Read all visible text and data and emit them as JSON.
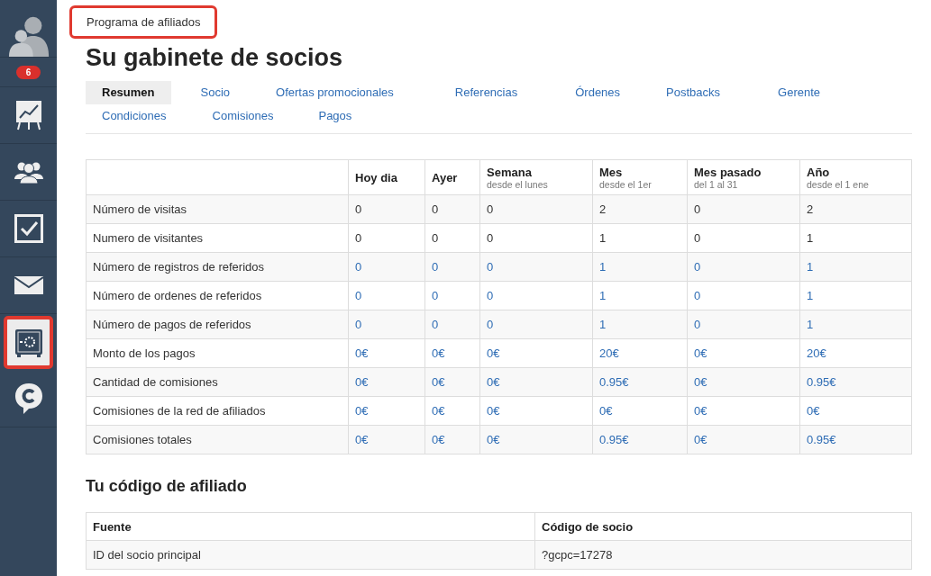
{
  "sidebar": {
    "badge": "6",
    "items": [
      {
        "kind": "chart",
        "selected": false,
        "highlighted": false
      },
      {
        "kind": "people",
        "selected": false,
        "highlighted": false
      },
      {
        "kind": "check",
        "selected": false,
        "highlighted": false
      },
      {
        "kind": "mail",
        "selected": false,
        "highlighted": false
      },
      {
        "kind": "safe",
        "selected": true,
        "highlighted": true
      },
      {
        "kind": "chat",
        "selected": false,
        "highlighted": false
      }
    ]
  },
  "breadcrumb": {
    "label": "Programa de afiliados",
    "highlighted": true
  },
  "title": "Su gabinete de socios",
  "tabs": [
    {
      "label": "Resumen",
      "selected": true
    },
    {
      "label": "Socio",
      "selected": false
    },
    {
      "label": "Ofertas promocionales",
      "selected": false
    },
    {
      "label": "Referencias",
      "selected": false
    },
    {
      "label": "Órdenes",
      "selected": false
    },
    {
      "label": "Postbacks",
      "selected": false
    },
    {
      "label": "Gerente",
      "selected": false
    },
    {
      "label": "Condiciones",
      "selected": false
    },
    {
      "label": "Comisiones",
      "selected": false
    },
    {
      "label": "Pagos",
      "selected": false
    }
  ],
  "stats_table": {
    "columns": [
      {
        "title": "Hoy dia"
      },
      {
        "title": "Ayer"
      },
      {
        "title": "Semana",
        "subtitle": "desde el lunes"
      },
      {
        "title": "Mes",
        "subtitle": "desde el 1er"
      },
      {
        "title": "Mes pasado",
        "subtitle": "del 1 al 31"
      },
      {
        "title": "Año",
        "subtitle": "desde el 1 ene"
      }
    ],
    "rows": [
      {
        "label": "Número de visitas",
        "linked": false,
        "values": [
          "0",
          "0",
          "0",
          "2",
          "0",
          "2"
        ]
      },
      {
        "label": "Numero de visitantes",
        "linked": false,
        "values": [
          "0",
          "0",
          "0",
          "1",
          "0",
          "1"
        ]
      },
      {
        "label": "Número de registros de referidos",
        "linked": true,
        "values": [
          "0",
          "0",
          "0",
          "1",
          "0",
          "1"
        ]
      },
      {
        "label": "Número de ordenes de referidos",
        "linked": true,
        "values": [
          "0",
          "0",
          "0",
          "1",
          "0",
          "1"
        ]
      },
      {
        "label": "Número de pagos de referidos",
        "linked": true,
        "values": [
          "0",
          "0",
          "0",
          "1",
          "0",
          "1"
        ]
      },
      {
        "label": "Monto de los pagos",
        "linked": true,
        "values": [
          "0€",
          "0€",
          "0€",
          "20€",
          "0€",
          "20€"
        ]
      },
      {
        "label": "Cantidad de comisiones",
        "linked": true,
        "values": [
          "0€",
          "0€",
          "0€",
          "0.95€",
          "0€",
          "0.95€"
        ]
      },
      {
        "label": "Comisiones de la red de afiliados",
        "linked": true,
        "values": [
          "0€",
          "0€",
          "0€",
          "0€",
          "0€",
          "0€"
        ]
      },
      {
        "label": "Comisiones totales",
        "linked": true,
        "values": [
          "0€",
          "0€",
          "0€",
          "0.95€",
          "0€",
          "0.95€"
        ]
      }
    ]
  },
  "code_section": {
    "title": "Tu código de afiliado",
    "columns": [
      "Fuente",
      "Código de socio"
    ],
    "rows": [
      [
        "ID del socio principal",
        "?gcpc=17278"
      ]
    ]
  }
}
